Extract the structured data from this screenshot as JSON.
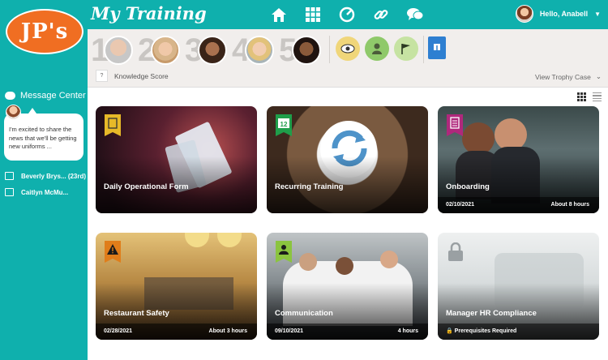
{
  "app": {
    "logo_text": "JP's",
    "title": "My Training"
  },
  "nav": {
    "icons": [
      "home-icon",
      "grid-icon",
      "gauge-icon",
      "link-icon",
      "chat-icon"
    ]
  },
  "user": {
    "greeting": "Hello, Anabell"
  },
  "sidebar": {
    "message_center_label": "Message Center",
    "message_text": "I'm excited to share the news that we'll be getting new uniforms ...",
    "celebrations": [
      {
        "icon": "calendar-icon",
        "text": "Beverly Brys... (23rd)"
      },
      {
        "icon": "gift-icon",
        "text": "Caitlyn McMu..."
      }
    ]
  },
  "leaderboard": {
    "ranks": [
      "1",
      "2",
      "3",
      "4",
      "5"
    ],
    "knowledge_score_badge": "?",
    "knowledge_score_label": "Knowledge Score",
    "trophy_label": "View Trophy Case"
  },
  "cards": [
    {
      "title": "Daily Operational Form",
      "date": "",
      "duration": "",
      "flag_color": "#e7b928"
    },
    {
      "title": "Recurring Training",
      "date": "",
      "duration": "",
      "flag_number": "12",
      "flag_color": "#1f9e4a"
    },
    {
      "title": "Onboarding",
      "date": "02/10/2021",
      "duration": "About 8 hours",
      "flag_color": "#b0287c"
    },
    {
      "title": "Restaurant Safety",
      "date": "02/28/2021",
      "duration": "About 3 hours",
      "flag_color": "#e07d1a"
    },
    {
      "title": "Communication",
      "date": "09/10/2021",
      "duration": "4 hours",
      "flag_color": "#8bc43f"
    },
    {
      "title": "Manager HR Compliance",
      "date": "",
      "duration": "",
      "lock_text": "Prerequisites Required"
    }
  ],
  "colors": {
    "teal": "#0fb0ad",
    "orange": "#f06e22"
  }
}
